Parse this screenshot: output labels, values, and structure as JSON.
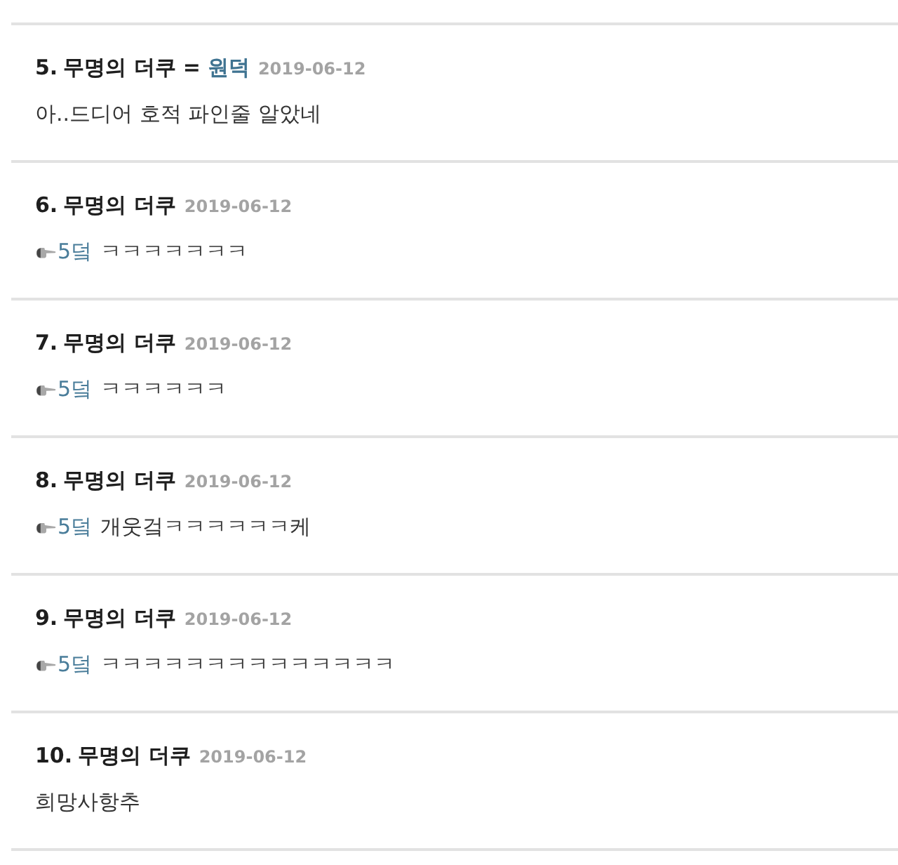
{
  "comments": [
    {
      "number": "5.",
      "author": "무명의 더쿠",
      "alias": {
        "separator": "=",
        "name": "원덕"
      },
      "date": "2019-06-12",
      "text": "아..드디어 호적 파인줄 알았네"
    },
    {
      "number": "6.",
      "author": "무명의 더쿠",
      "date": "2019-06-12",
      "reply_to": "5덬",
      "text": "ㅋㅋㅋㅋㅋㅋㅋ"
    },
    {
      "number": "7.",
      "author": "무명의 더쿠",
      "date": "2019-06-12",
      "reply_to": "5덬",
      "text": "ㅋㅋㅋㅋㅋㅋ"
    },
    {
      "number": "8.",
      "author": "무명의 더쿠",
      "date": "2019-06-12",
      "reply_to": "5덬",
      "text": "개웃겈ㅋㅋㅋㅋㅋㅋ케"
    },
    {
      "number": "9.",
      "author": "무명의 더쿠",
      "date": "2019-06-12",
      "reply_to": "5덬",
      "text": "ㅋㅋㅋㅋㅋㅋㅋㅋㅋㅋㅋㅋㅋㅋ"
    },
    {
      "number": "10.",
      "author": "무명의 더쿠",
      "date": "2019-06-12",
      "text": "희망사항추"
    }
  ]
}
